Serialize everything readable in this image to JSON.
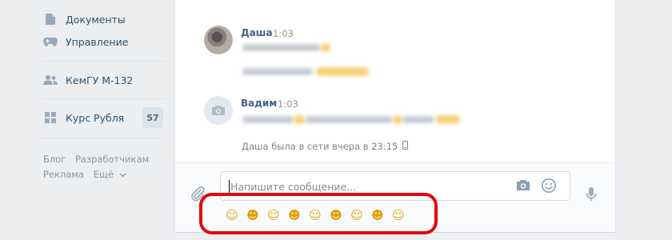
{
  "sidebar": {
    "items": [
      {
        "label": "Документы",
        "icon": "document-icon"
      },
      {
        "label": "Управление",
        "icon": "gamepad-icon"
      },
      {
        "label": "КемГУ М-132",
        "icon": "group-icon"
      },
      {
        "label": "Курс Рубля",
        "icon": "apps-icon",
        "count": "57"
      }
    ],
    "footer": {
      "blog": "Блог",
      "developers": "Разработчикам",
      "ads": "Реклама",
      "more": "Ещё"
    }
  },
  "chat": {
    "messages": [
      {
        "author": "Даша",
        "time": "1:03",
        "avatar": "user-photo"
      },
      {
        "author": "Вадим",
        "time": "1:03",
        "avatar": "camera-placeholder"
      }
    ],
    "status": "Даша была в сети вчера в 23:15"
  },
  "composer": {
    "placeholder": "Напишите сообщение...",
    "emojis": [
      "☺",
      "☻",
      "☺",
      "☻",
      "☺",
      "☻",
      "☺",
      "☻",
      "☺"
    ]
  },
  "colors": {
    "link": "#285473",
    "author": "#42648b",
    "highlight": "#e30613"
  }
}
